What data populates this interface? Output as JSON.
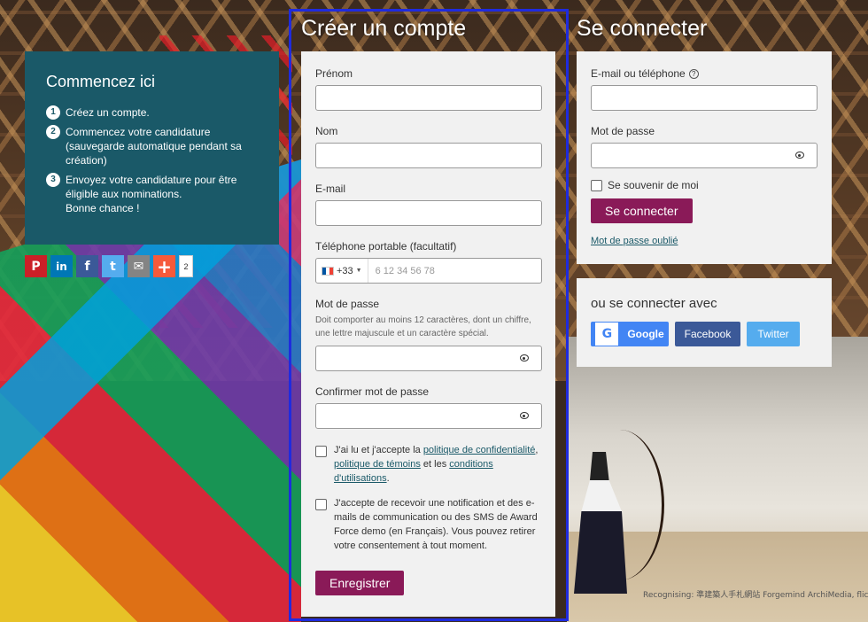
{
  "start": {
    "title": "Commencez ici",
    "steps": [
      {
        "num": "1",
        "text": "Créez un compte."
      },
      {
        "num": "2",
        "text": "Commencez votre candidature (sauvegarde automatique pendant sa création)"
      },
      {
        "num": "3",
        "text": "Envoyez votre candidature pour être éligible aux nominations.",
        "text2": "Bonne chance !"
      }
    ]
  },
  "share": {
    "count": "2",
    "icons": {
      "pinterest": "P",
      "linkedin": "in",
      "facebook": "f",
      "twitter": "t",
      "email": "✉",
      "add": "+"
    }
  },
  "register": {
    "title": "Créer un compte",
    "first_name_label": "Prénom",
    "last_name_label": "Nom",
    "email_label": "E-mail",
    "phone_label": "Téléphone portable (facultatif)",
    "phone_prefix": "+33",
    "phone_placeholder": "6 12 34 56 78",
    "password_label": "Mot de passe",
    "password_hint": "Doit comporter au moins 12 caractères, dont un chiffre, une lettre majuscule et un caractère spécial.",
    "confirm_label": "Confirmer mot de passe",
    "consent1_pre": "J'ai lu et j'accepte la ",
    "consent1_link1": "politique de confidentialité",
    "consent1_sep": ", ",
    "consent1_link2": "politique de témoins",
    "consent1_and": " et les ",
    "consent1_link3": "conditions d'utilisations",
    "consent1_end": ".",
    "consent2": "J'accepte de recevoir une notification et des e-mails de communication ou des SMS de Award Force demo (en Français). Vous pouvez retirer votre consentement à tout moment.",
    "submit_label": "Enregistrer"
  },
  "login": {
    "title": "Se connecter",
    "identifier_label": "E-mail ou téléphone",
    "help_glyph": "?",
    "password_label": "Mot de passe",
    "remember_label": "Se souvenir de moi",
    "submit_label": "Se connecter",
    "forgot_label": "Mot de passe oublié"
  },
  "social_login": {
    "title": "ou se connecter avec",
    "google_label": "Google",
    "google_glyph": "G",
    "facebook_label": "Facebook",
    "twitter_label": "Twitter"
  },
  "credit": "Recognising: 準建築人手札網站 Forgemind ArchiMedia, flickr.com/"
}
